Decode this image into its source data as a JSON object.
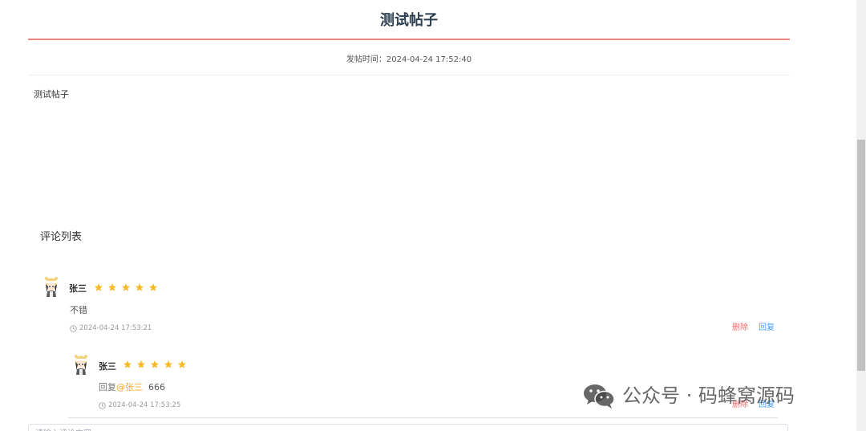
{
  "post": {
    "title": "测试帖子",
    "meta_label": "发帖时间：",
    "meta_time": "2024-04-24 17:52:40",
    "body": "测试帖子"
  },
  "comments_section": {
    "heading": "评论列表"
  },
  "comments": [
    {
      "author": "张三",
      "rating": 5,
      "text": "不错",
      "time": "2024-04-24 17:53:21",
      "delete_label": "删除",
      "reply_label": "回复"
    }
  ],
  "replies": [
    {
      "author": "张三",
      "rating": 5,
      "reply_prefix": "回复",
      "reply_target": "@张三",
      "text": "666",
      "time": "2024-04-24 17:53:25",
      "delete_label": "删除",
      "reply_label": "回复"
    }
  ],
  "comment_input": {
    "placeholder": "请输入评论内容"
  },
  "watermark": {
    "text": "公众号 · 码蜂窝源码"
  },
  "colors": {
    "title_rule": "#f08585",
    "star": "#f7ba2a",
    "delete": "#f56c6c",
    "reply": "#409eff",
    "reply_target": "#f5a623"
  },
  "icons": [
    "avatar-icon",
    "star-icon",
    "clock-icon",
    "wechat-icon"
  ]
}
